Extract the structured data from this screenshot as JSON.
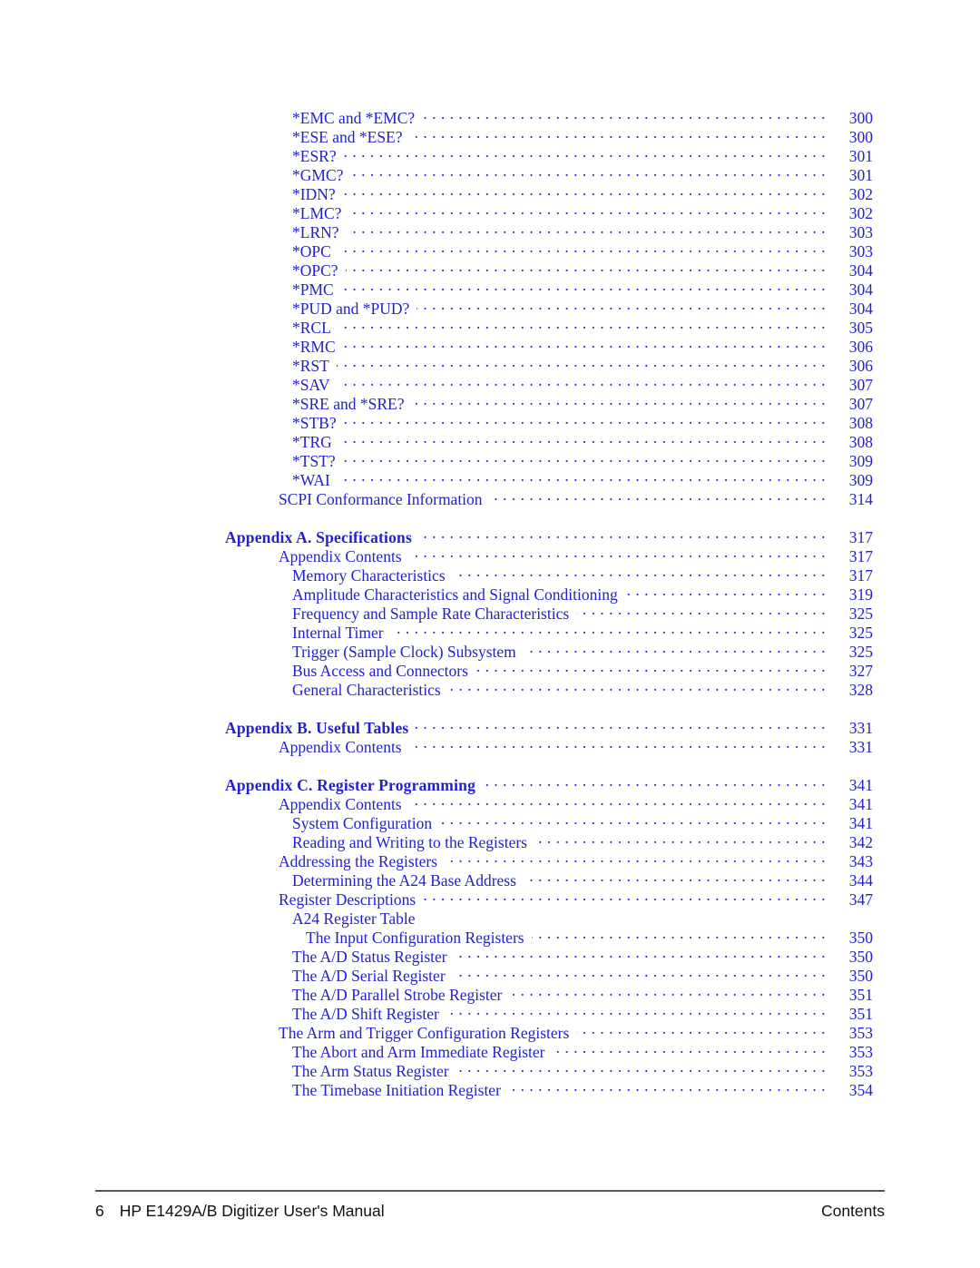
{
  "document": {
    "title": "HP E1429A/B Digitizer User's Manual",
    "section": "Contents",
    "page_number": "6",
    "text_color": "#2222cc",
    "footer_color": "#111111"
  },
  "toc": {
    "entries": [
      {
        "label": "*EMC and *EMC?",
        "page": "300",
        "level": 2,
        "bold": false,
        "leader": true,
        "gap_before": false
      },
      {
        "label": "*ESE and *ESE?",
        "page": "300",
        "level": 2,
        "bold": false,
        "leader": true,
        "gap_before": false
      },
      {
        "label": "*ESR?",
        "page": "301",
        "level": 2,
        "bold": false,
        "leader": true,
        "gap_before": false
      },
      {
        "label": "*GMC?",
        "page": "301",
        "level": 2,
        "bold": false,
        "leader": true,
        "gap_before": false
      },
      {
        "label": "*IDN?",
        "page": "302",
        "level": 2,
        "bold": false,
        "leader": true,
        "gap_before": false
      },
      {
        "label": "*LMC?",
        "page": "302",
        "level": 2,
        "bold": false,
        "leader": true,
        "gap_before": false
      },
      {
        "label": "*LRN?",
        "page": "303",
        "level": 2,
        "bold": false,
        "leader": true,
        "gap_before": false
      },
      {
        "label": "*OPC",
        "page": "303",
        "level": 2,
        "bold": false,
        "leader": true,
        "gap_before": false
      },
      {
        "label": "*OPC?",
        "page": "304",
        "level": 2,
        "bold": false,
        "leader": true,
        "gap_before": false
      },
      {
        "label": "*PMC",
        "page": "304",
        "level": 2,
        "bold": false,
        "leader": true,
        "gap_before": false
      },
      {
        "label": "*PUD and *PUD?",
        "page": "304",
        "level": 2,
        "bold": false,
        "leader": true,
        "gap_before": false
      },
      {
        "label": "*RCL",
        "page": "305",
        "level": 2,
        "bold": false,
        "leader": true,
        "gap_before": false
      },
      {
        "label": "*RMC",
        "page": "306",
        "level": 2,
        "bold": false,
        "leader": true,
        "gap_before": false
      },
      {
        "label": "*RST",
        "page": "306",
        "level": 2,
        "bold": false,
        "leader": true,
        "gap_before": false
      },
      {
        "label": "*SAV",
        "page": "307",
        "level": 2,
        "bold": false,
        "leader": true,
        "gap_before": false
      },
      {
        "label": "*SRE and *SRE?",
        "page": "307",
        "level": 2,
        "bold": false,
        "leader": true,
        "gap_before": false
      },
      {
        "label": "*STB?",
        "page": "308",
        "level": 2,
        "bold": false,
        "leader": true,
        "gap_before": false
      },
      {
        "label": "*TRG",
        "page": "308",
        "level": 2,
        "bold": false,
        "leader": true,
        "gap_before": false
      },
      {
        "label": "*TST?",
        "page": "309",
        "level": 2,
        "bold": false,
        "leader": true,
        "gap_before": false
      },
      {
        "label": "*WAI",
        "page": "309",
        "level": 2,
        "bold": false,
        "leader": true,
        "gap_before": false
      },
      {
        "label": "SCPI Conformance Information",
        "page": "314",
        "level": 1,
        "bold": false,
        "leader": true,
        "gap_before": false
      },
      {
        "label": "Appendix  A.  Specifications",
        "page": "317",
        "level": 0,
        "bold": true,
        "leader": true,
        "gap_before": true
      },
      {
        "label": "Appendix Contents",
        "page": "317",
        "level": 1,
        "bold": false,
        "leader": true,
        "gap_before": false
      },
      {
        "label": "Memory Characteristics",
        "page": "317",
        "level": 2,
        "bold": false,
        "leader": true,
        "gap_before": false
      },
      {
        "label": "Amplitude Characteristics and Signal Conditioning",
        "page": "319",
        "level": 2,
        "bold": false,
        "leader": true,
        "gap_before": false
      },
      {
        "label": "Frequency and Sample Rate Characteristics",
        "page": "325",
        "level": 2,
        "bold": false,
        "leader": true,
        "gap_before": false
      },
      {
        "label": "Internal Timer",
        "page": "325",
        "level": 2,
        "bold": false,
        "leader": true,
        "gap_before": false
      },
      {
        "label": "Trigger (Sample Clock) Subsystem",
        "page": "325",
        "level": 2,
        "bold": false,
        "leader": true,
        "gap_before": false
      },
      {
        "label": "Bus Access and Connectors",
        "page": "327",
        "level": 2,
        "bold": false,
        "leader": true,
        "gap_before": false
      },
      {
        "label": "General Characteristics",
        "page": "328",
        "level": 2,
        "bold": false,
        "leader": true,
        "gap_before": false
      },
      {
        "label": "Appendix  B.  Useful Tables",
        "page": "331",
        "level": 0,
        "bold": true,
        "leader": true,
        "gap_before": true
      },
      {
        "label": "Appendix Contents",
        "page": "331",
        "level": 1,
        "bold": false,
        "leader": true,
        "gap_before": false
      },
      {
        "label": "Appendix  C.  Register Programming",
        "page": "341",
        "level": 0,
        "bold": true,
        "leader": true,
        "gap_before": true
      },
      {
        "label": "Appendix Contents",
        "page": "341",
        "level": 1,
        "bold": false,
        "leader": true,
        "gap_before": false
      },
      {
        "label": "System Configuration",
        "page": "341",
        "level": 2,
        "bold": false,
        "leader": true,
        "gap_before": false
      },
      {
        "label": "Reading and Writing to the Registers",
        "page": "342",
        "level": 2,
        "bold": false,
        "leader": true,
        "gap_before": false
      },
      {
        "label": "Addressing the Registers",
        "page": "343",
        "level": 1,
        "bold": false,
        "leader": true,
        "gap_before": false
      },
      {
        "label": "Determining the A24 Base Address",
        "page": "344",
        "level": 2,
        "bold": false,
        "leader": true,
        "gap_before": false
      },
      {
        "label": "Register Descriptions",
        "page": "347",
        "level": 1,
        "bold": false,
        "leader": true,
        "gap_before": false
      },
      {
        "label": "A24 Register Table",
        "page": "",
        "level": 2,
        "bold": false,
        "leader": false,
        "gap_before": false
      },
      {
        "label": "The Input Configuration Registers",
        "page": "350",
        "level": 3,
        "bold": false,
        "leader": true,
        "gap_before": false
      },
      {
        "label": "The A/D Status Register",
        "page": "350",
        "level": 2,
        "bold": false,
        "leader": true,
        "gap_before": false
      },
      {
        "label": "The A/D Serial Register",
        "page": "350",
        "level": 2,
        "bold": false,
        "leader": true,
        "gap_before": false
      },
      {
        "label": "The A/D Parallel Strobe Register",
        "page": "351",
        "level": 2,
        "bold": false,
        "leader": true,
        "gap_before": false
      },
      {
        "label": "The A/D Shift Register",
        "page": "351",
        "level": 2,
        "bold": false,
        "leader": true,
        "gap_before": false
      },
      {
        "label": "The Arm and Trigger Configuration Registers",
        "page": "353",
        "level": 1,
        "bold": false,
        "leader": true,
        "gap_before": false
      },
      {
        "label": "The Abort and Arm Immediate Register",
        "page": "353",
        "level": 2,
        "bold": false,
        "leader": true,
        "gap_before": false
      },
      {
        "label": "The Arm Status Register",
        "page": "353",
        "level": 2,
        "bold": false,
        "leader": true,
        "gap_before": false
      },
      {
        "label": "The Timebase Initiation Register",
        "page": "354",
        "level": 2,
        "bold": false,
        "leader": true,
        "gap_before": false
      }
    ]
  }
}
